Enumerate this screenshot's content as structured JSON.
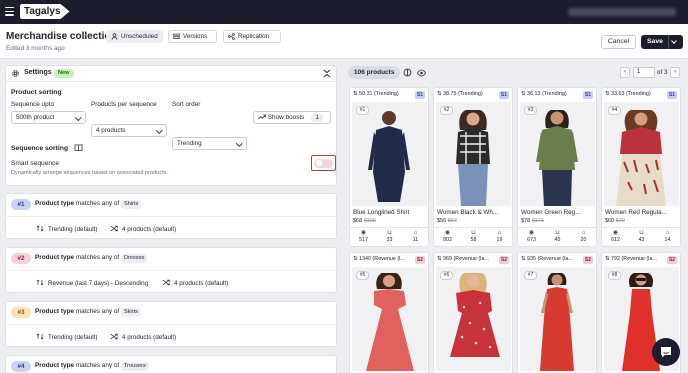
{
  "topbar": {
    "brand": "Tagalys"
  },
  "header": {
    "title": "Merchandise collection",
    "subtitle": "Edited 3 months ago",
    "chips": {
      "unscheduled": "Unscheduled",
      "versions": "Versions",
      "replication": "Replication"
    },
    "cancel": "Cancel",
    "save": "Save"
  },
  "settings": {
    "title": "Settings",
    "new_badge": "New",
    "product_sorting": "Product sorting",
    "sequence_upto_label": "Sequence upto",
    "sequence_upto_value": "500th product",
    "per_sequence_label": "Products per sequence",
    "per_sequence_value": "4 products",
    "sort_order_label": "Sort order",
    "sort_order_value": "Trending",
    "show_boosts": "Show boosts",
    "boost_count": "1",
    "sequence_sorting": "Sequence sorting",
    "smart_sequence": "Smart sequence",
    "smart_sequence_desc": "Dynamically arrange sequences based on associated products."
  },
  "sequences": [
    {
      "num": "#1",
      "field": "Product type",
      "op": "matches any of",
      "value": "Shirts",
      "sort": "Trending (default)",
      "count": "4 products (default)"
    },
    {
      "num": "#2",
      "field": "Product type",
      "op": "matches any of",
      "value": "Dresses",
      "sort": "Revenue (last 7 days) - Descending",
      "count": "4 products (default)"
    },
    {
      "num": "#3",
      "field": "Product type",
      "op": "matches any of",
      "value": "Skirts",
      "sort": "Trending (default)",
      "count": "4 products (default)"
    },
    {
      "num": "#4",
      "field": "Product type",
      "op": "matches any of",
      "value": "Trousers"
    }
  ],
  "colors": {
    "seq1": "#c9d3f6",
    "seq2": "#f8cfdb",
    "seq3": "#fbe3b6",
    "seq4": "#c9d3f6",
    "accent_red": "#b5432f"
  },
  "results": {
    "count": "106 products",
    "page": "1",
    "of": "of 3"
  },
  "products_row1": [
    {
      "score": "50.31 (Trending)",
      "rank": "#1",
      "seq": "S1",
      "name": "Blue Longlined Shirt",
      "price": "$68",
      "old": "$106",
      "views": "517",
      "carts": "33",
      "orders": "11"
    },
    {
      "score": "38.75 (Trending)",
      "rank": "#2",
      "seq": "S1",
      "name": "Women Black & Wh...",
      "price": "$56",
      "old": "$67",
      "views": "802",
      "carts": "58",
      "orders": "19"
    },
    {
      "score": "36.13 (Trending)",
      "rank": "#3",
      "seq": "S1",
      "name": "Women Green Reg...",
      "price": "$78",
      "old": "$171",
      "views": "673",
      "carts": "45",
      "orders": "20"
    },
    {
      "score": "33.63 (Trending)",
      "rank": "#4",
      "seq": "S1",
      "name": "Women Red Regula...",
      "price": "$60",
      "old": "$70",
      "views": "612",
      "carts": "43",
      "orders": "14"
    }
  ],
  "products_row2": [
    {
      "score": "1340 (Revenue (l...",
      "rank": "#5",
      "seq": "S2"
    },
    {
      "score": "969 (Revenue (la...",
      "rank": "#6",
      "seq": "S2"
    },
    {
      "score": "935 (Revenue (la...",
      "rank": "#7",
      "seq": "S2"
    },
    {
      "score": "792 (Revenue (la...",
      "rank": "#8",
      "seq": "S2"
    }
  ]
}
